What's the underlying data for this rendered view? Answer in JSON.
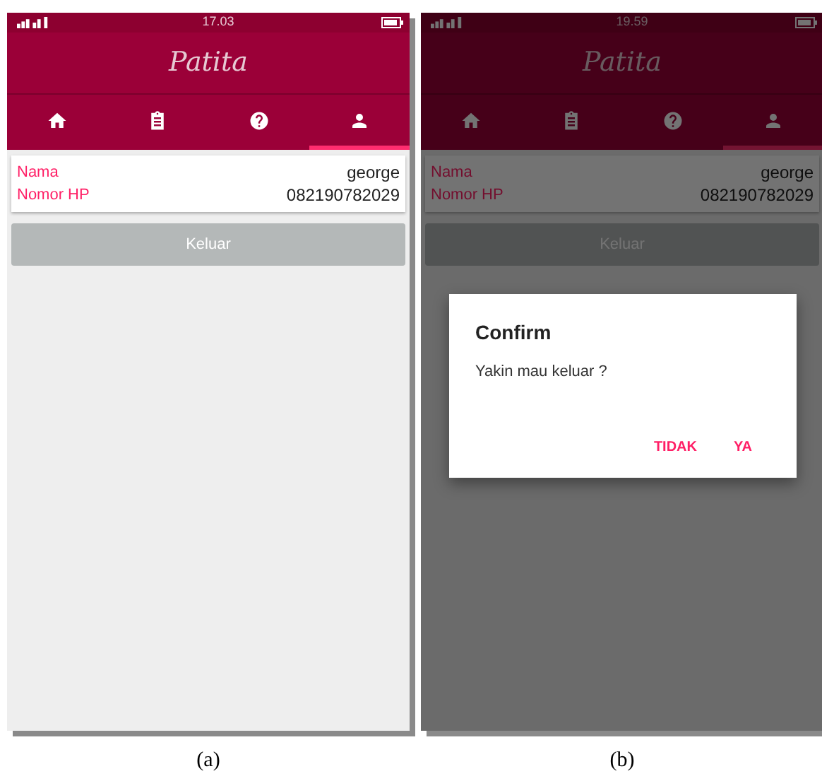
{
  "screens": [
    {
      "status": {
        "time": "17.03"
      },
      "app_title": "Patita",
      "tabs": [
        {
          "kind": "home",
          "selected": false
        },
        {
          "kind": "clipboard",
          "selected": false
        },
        {
          "kind": "help",
          "selected": false
        },
        {
          "kind": "person",
          "selected": true
        }
      ],
      "fields": [
        {
          "label": "Nama",
          "value": "george"
        },
        {
          "label": "Nomor HP",
          "value": "082190782029"
        }
      ],
      "logout_button": {
        "label": "Keluar",
        "disabled": true
      },
      "caption": "(a)"
    },
    {
      "status": {
        "time": "19.59"
      },
      "app_title": "Patita",
      "tabs": [
        {
          "kind": "home",
          "selected": false
        },
        {
          "kind": "clipboard",
          "selected": false
        },
        {
          "kind": "help",
          "selected": false
        },
        {
          "kind": "person",
          "selected": true
        }
      ],
      "fields": [
        {
          "label": "Nama",
          "value": "george"
        },
        {
          "label": "Nomor HP",
          "value": "082190782029"
        }
      ],
      "logout_button": {
        "label": "Keluar",
        "disabled": true
      },
      "dialog": {
        "title": "Confirm",
        "message": "Yakin mau keluar ?",
        "buttons": [
          "TIDAK",
          "YA"
        ]
      },
      "caption": "(b)"
    }
  ]
}
